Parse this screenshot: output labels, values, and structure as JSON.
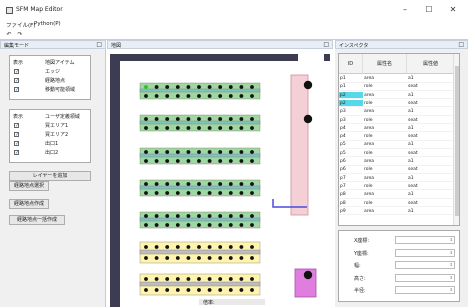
{
  "window": {
    "title": "SFM Map Editor",
    "minimize": "–",
    "maximize": "☐",
    "close": "✕"
  },
  "menu": [
    "ファイル(F)",
    "Python(P)"
  ],
  "toolbar": {
    "undo_icon": "↶",
    "redo_icon": "↷"
  },
  "left_panel": {
    "title": "編集モード",
    "close": "□",
    "layers_header": {
      "col1": "表示",
      "col2": "地図アイテム"
    },
    "layers": [
      {
        "checked": true,
        "label": "エッジ"
      },
      {
        "checked": true,
        "label": "経路地点"
      },
      {
        "checked": true,
        "label": "移動可能領域"
      }
    ],
    "user_layers_header": {
      "col1": "表示",
      "col2": "ユーザ定義領域"
    },
    "user_layers": [
      {
        "checked": true,
        "label": "買エリア1"
      },
      {
        "checked": true,
        "label": "買エリア2"
      },
      {
        "checked": true,
        "label": "出口1"
      },
      {
        "checked": true,
        "label": "出口2"
      }
    ],
    "add_layer_button": "レイヤーを追加",
    "buttons": [
      "経路地点選択",
      "経路地点作成",
      "経路地点一括作成"
    ]
  },
  "map_panel": {
    "title": "地図",
    "close": "□",
    "zoom_label": "倍率:"
  },
  "right_panel": {
    "title": "インスペクタ",
    "close": "□",
    "columns": [
      "ID",
      "属性名",
      "属性値"
    ],
    "rows": [
      [
        "p1",
        "area",
        "a1"
      ],
      [
        "p1",
        "role",
        "seat"
      ],
      [
        "p2",
        "area",
        "a1"
      ],
      [
        "p2",
        "role",
        "seat"
      ],
      [
        "p3",
        "area",
        "a1"
      ],
      [
        "p3",
        "role",
        "seat"
      ],
      [
        "p4",
        "area",
        "a1"
      ],
      [
        "p4",
        "role",
        "seat"
      ],
      [
        "p5",
        "area",
        "a1"
      ],
      [
        "p5",
        "role",
        "seat"
      ],
      [
        "p6",
        "area",
        "a1"
      ],
      [
        "p6",
        "role",
        "seat"
      ],
      [
        "p7",
        "area",
        "a1"
      ],
      [
        "p7",
        "role",
        "seat"
      ],
      [
        "p8",
        "area",
        "a1"
      ],
      [
        "p8",
        "role",
        "seat"
      ],
      [
        "p9",
        "area",
        "a1"
      ]
    ],
    "selected_row": "p2",
    "coords": [
      "X座標:",
      "Y座標:",
      "幅:",
      "高さ:",
      "半径:"
    ]
  },
  "colors": {
    "table_green": "#9fd7a0",
    "table_cyan": "#7fc4c0",
    "table_yellow": "#fff3b0",
    "table_gray": "#bdbdbd",
    "wall_dark": "#3c3c52",
    "door_pink": "#f4cfd6",
    "door_magenta": "#e07ee0",
    "edge_blue": "#4a4adf",
    "selected_cyan": "#55d8e8"
  }
}
